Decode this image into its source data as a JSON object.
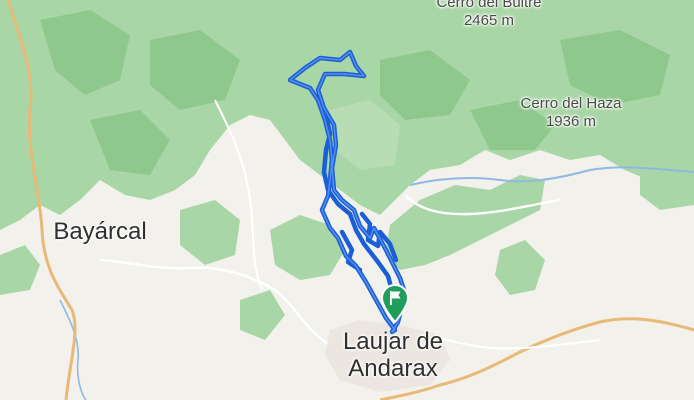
{
  "map": {
    "labels": {
      "peak_bultre_name": "Cerro del Bultre",
      "peak_bultre_elev": "2465 m",
      "peak_haza_name": "Cerro del Haza",
      "peak_haza_elev": "1936 m",
      "town_bayarcal": "Bayárcal",
      "town_laujar_line1": "Laujar de",
      "town_laujar_line2": "Andarax"
    },
    "route": {
      "color": "#1a5fd6",
      "shape": "loop track"
    },
    "marker": {
      "icon": "flag-pin-icon",
      "color": "#1e9e5a"
    },
    "colors": {
      "forest": "#a9d6a6",
      "forest_dark": "#8ec88c",
      "land": "#f3f1ec",
      "road_major": "#e9b978",
      "river": "#8fb9e3"
    }
  }
}
